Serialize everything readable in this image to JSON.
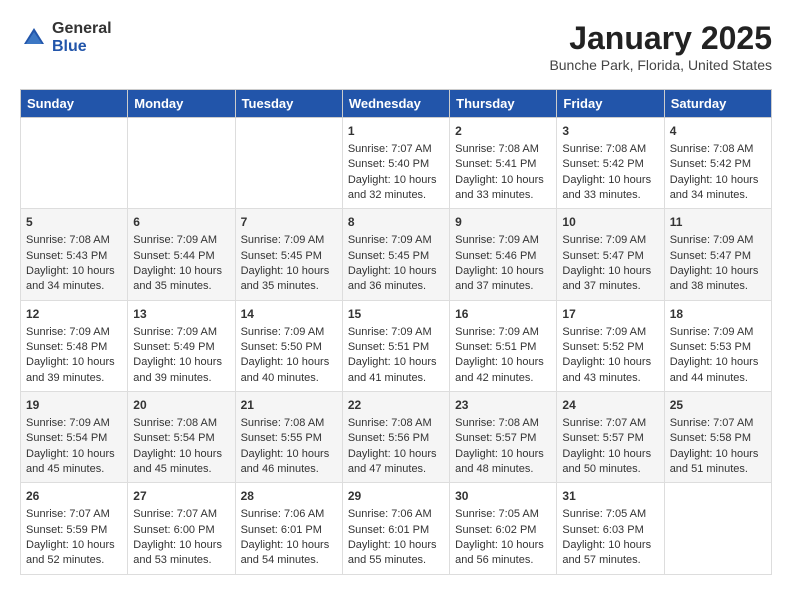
{
  "header": {
    "logo_general": "General",
    "logo_blue": "Blue",
    "title": "January 2025",
    "subtitle": "Bunche Park, Florida, United States"
  },
  "weekdays": [
    "Sunday",
    "Monday",
    "Tuesday",
    "Wednesday",
    "Thursday",
    "Friday",
    "Saturday"
  ],
  "weeks": [
    [
      {
        "day": "",
        "content": ""
      },
      {
        "day": "",
        "content": ""
      },
      {
        "day": "",
        "content": ""
      },
      {
        "day": "1",
        "content": "Sunrise: 7:07 AM\nSunset: 5:40 PM\nDaylight: 10 hours\nand 32 minutes."
      },
      {
        "day": "2",
        "content": "Sunrise: 7:08 AM\nSunset: 5:41 PM\nDaylight: 10 hours\nand 33 minutes."
      },
      {
        "day": "3",
        "content": "Sunrise: 7:08 AM\nSunset: 5:42 PM\nDaylight: 10 hours\nand 33 minutes."
      },
      {
        "day": "4",
        "content": "Sunrise: 7:08 AM\nSunset: 5:42 PM\nDaylight: 10 hours\nand 34 minutes."
      }
    ],
    [
      {
        "day": "5",
        "content": "Sunrise: 7:08 AM\nSunset: 5:43 PM\nDaylight: 10 hours\nand 34 minutes."
      },
      {
        "day": "6",
        "content": "Sunrise: 7:09 AM\nSunset: 5:44 PM\nDaylight: 10 hours\nand 35 minutes."
      },
      {
        "day": "7",
        "content": "Sunrise: 7:09 AM\nSunset: 5:45 PM\nDaylight: 10 hours\nand 35 minutes."
      },
      {
        "day": "8",
        "content": "Sunrise: 7:09 AM\nSunset: 5:45 PM\nDaylight: 10 hours\nand 36 minutes."
      },
      {
        "day": "9",
        "content": "Sunrise: 7:09 AM\nSunset: 5:46 PM\nDaylight: 10 hours\nand 37 minutes."
      },
      {
        "day": "10",
        "content": "Sunrise: 7:09 AM\nSunset: 5:47 PM\nDaylight: 10 hours\nand 37 minutes."
      },
      {
        "day": "11",
        "content": "Sunrise: 7:09 AM\nSunset: 5:47 PM\nDaylight: 10 hours\nand 38 minutes."
      }
    ],
    [
      {
        "day": "12",
        "content": "Sunrise: 7:09 AM\nSunset: 5:48 PM\nDaylight: 10 hours\nand 39 minutes."
      },
      {
        "day": "13",
        "content": "Sunrise: 7:09 AM\nSunset: 5:49 PM\nDaylight: 10 hours\nand 39 minutes."
      },
      {
        "day": "14",
        "content": "Sunrise: 7:09 AM\nSunset: 5:50 PM\nDaylight: 10 hours\nand 40 minutes."
      },
      {
        "day": "15",
        "content": "Sunrise: 7:09 AM\nSunset: 5:51 PM\nDaylight: 10 hours\nand 41 minutes."
      },
      {
        "day": "16",
        "content": "Sunrise: 7:09 AM\nSunset: 5:51 PM\nDaylight: 10 hours\nand 42 minutes."
      },
      {
        "day": "17",
        "content": "Sunrise: 7:09 AM\nSunset: 5:52 PM\nDaylight: 10 hours\nand 43 minutes."
      },
      {
        "day": "18",
        "content": "Sunrise: 7:09 AM\nSunset: 5:53 PM\nDaylight: 10 hours\nand 44 minutes."
      }
    ],
    [
      {
        "day": "19",
        "content": "Sunrise: 7:09 AM\nSunset: 5:54 PM\nDaylight: 10 hours\nand 45 minutes."
      },
      {
        "day": "20",
        "content": "Sunrise: 7:08 AM\nSunset: 5:54 PM\nDaylight: 10 hours\nand 45 minutes."
      },
      {
        "day": "21",
        "content": "Sunrise: 7:08 AM\nSunset: 5:55 PM\nDaylight: 10 hours\nand 46 minutes."
      },
      {
        "day": "22",
        "content": "Sunrise: 7:08 AM\nSunset: 5:56 PM\nDaylight: 10 hours\nand 47 minutes."
      },
      {
        "day": "23",
        "content": "Sunrise: 7:08 AM\nSunset: 5:57 PM\nDaylight: 10 hours\nand 48 minutes."
      },
      {
        "day": "24",
        "content": "Sunrise: 7:07 AM\nSunset: 5:57 PM\nDaylight: 10 hours\nand 50 minutes."
      },
      {
        "day": "25",
        "content": "Sunrise: 7:07 AM\nSunset: 5:58 PM\nDaylight: 10 hours\nand 51 minutes."
      }
    ],
    [
      {
        "day": "26",
        "content": "Sunrise: 7:07 AM\nSunset: 5:59 PM\nDaylight: 10 hours\nand 52 minutes."
      },
      {
        "day": "27",
        "content": "Sunrise: 7:07 AM\nSunset: 6:00 PM\nDaylight: 10 hours\nand 53 minutes."
      },
      {
        "day": "28",
        "content": "Sunrise: 7:06 AM\nSunset: 6:01 PM\nDaylight: 10 hours\nand 54 minutes."
      },
      {
        "day": "29",
        "content": "Sunrise: 7:06 AM\nSunset: 6:01 PM\nDaylight: 10 hours\nand 55 minutes."
      },
      {
        "day": "30",
        "content": "Sunrise: 7:05 AM\nSunset: 6:02 PM\nDaylight: 10 hours\nand 56 minutes."
      },
      {
        "day": "31",
        "content": "Sunrise: 7:05 AM\nSunset: 6:03 PM\nDaylight: 10 hours\nand 57 minutes."
      },
      {
        "day": "",
        "content": ""
      }
    ]
  ]
}
